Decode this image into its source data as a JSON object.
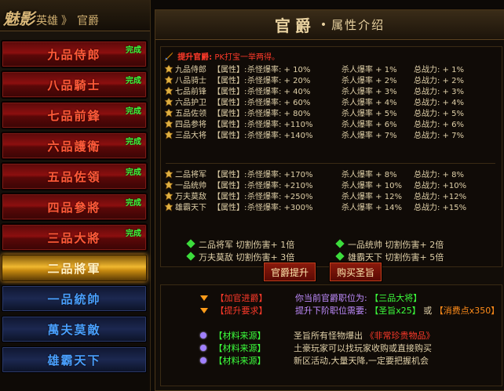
{
  "left": {
    "title_big": "魅影",
    "title_hero": "英雄",
    "title_sep": "》",
    "title_rank": "官爵",
    "ranks": [
      {
        "label": "九品侍郎",
        "badge": "完成",
        "state": "done"
      },
      {
        "label": "八品騎士",
        "badge": "完成",
        "state": "done"
      },
      {
        "label": "七品前鋒",
        "badge": "完成",
        "state": "done"
      },
      {
        "label": "六品護衛",
        "badge": "完成",
        "state": "done"
      },
      {
        "label": "五品佐領",
        "badge": "完成",
        "state": "done"
      },
      {
        "label": "四品參將",
        "badge": "完成",
        "state": "done"
      },
      {
        "label": "三品大將",
        "badge": "完成",
        "state": "done"
      },
      {
        "label": "二品將軍",
        "badge": "",
        "state": "current"
      },
      {
        "label": "一品統帥",
        "badge": "",
        "state": "locked"
      },
      {
        "label": "萬夫莫敵",
        "badge": "",
        "state": "locked"
      },
      {
        "label": "雄霸天下",
        "badge": "",
        "state": "locked"
      }
    ]
  },
  "right": {
    "title": "官爵",
    "dot": "•",
    "subtitle": "属性介绍",
    "tip_prefix": "提升官爵:",
    "tip_text": "PK打宝一举两得。",
    "rows": [
      {
        "name": "九品侍郎",
        "attr": "【属性】:",
        "c1": "杀怪爆率: + 10%",
        "c2": "杀人爆率 +  1%",
        "c3": "总战力: + 1%"
      },
      {
        "name": "八品骑士",
        "attr": "【属性】:",
        "c1": "杀怪爆率: + 20%",
        "c2": "杀人爆率 +  2%",
        "c3": "总战力: + 2%"
      },
      {
        "name": "七品前锋",
        "attr": "【属性】:",
        "c1": "杀怪爆率: + 40%",
        "c2": "杀人爆率 +  3%",
        "c3": "总战力: + 3%"
      },
      {
        "name": "六品护卫",
        "attr": "【属性】:",
        "c1": "杀怪爆率: + 60%",
        "c2": "杀人爆率 +  4%",
        "c3": "总战力: + 4%"
      },
      {
        "name": "五品佐领",
        "attr": "【属性】:",
        "c1": "杀怪爆率: + 80%",
        "c2": "杀人爆率 +  5%",
        "c3": "总战力: + 5%"
      },
      {
        "name": "四品参将",
        "attr": "【属性】:",
        "c1": "杀怪爆率: +110%",
        "c2": "杀人爆率 +  6%",
        "c3": "总战力: + 6%"
      },
      {
        "name": "三品大将",
        "attr": "【属性】:",
        "c1": "杀怪爆率: +140%",
        "c2": "杀人爆率 +  7%",
        "c3": "总战力: + 7%"
      },
      {
        "name": "二品将军",
        "attr": "【属性】:",
        "c1": "杀怪爆率: +170%",
        "c2": "杀人爆率 +  8%",
        "c3": "总战力: + 8%"
      },
      {
        "name": "一品统帅",
        "attr": "【属性】:",
        "c1": "杀怪爆率: +210%",
        "c2": "杀人爆率 + 10%",
        "c3": "总战力: +10%"
      },
      {
        "name": "万夫莫敌",
        "attr": "【属性】:",
        "c1": "杀怪爆率: +250%",
        "c2": "杀人爆率 + 12%",
        "c3": "总战力: +12%"
      },
      {
        "name": "雄霸天下",
        "attr": "【属性】:",
        "c1": "杀怪爆率: +300%",
        "c2": "杀人爆率 + 14%",
        "c3": "总战力: +15%"
      }
    ],
    "bonuses": [
      "二品将军  切割伤害+ 1倍",
      "一品统帅  切割伤害+ 2倍",
      "万夫莫敌  切割伤害+ 3倍",
      "雄霸天下  切割伤害+ 5倍"
    ],
    "btn_promote": "官爵提升",
    "btn_buy": "购买圣旨",
    "notes": {
      "n1_tag": "【加官进爵】",
      "n1_text": "你当前官爵职位为:",
      "n1_val": "【三品大将】",
      "n2_tag": "【提升要求】",
      "n2_text": "提升下阶职位需要:",
      "n2_v1": "【圣旨x25】",
      "n2_or": "或",
      "n2_v2": "【消费点x350】",
      "n3_tag": "【材料来源】",
      "n3_text": "圣旨所有怪物爆出",
      "n3_val": "《非常珍贵物品》",
      "n4_tag": "【材料来源】",
      "n4_text": "土豪玩家可以找玩家收购或直接购买",
      "n5_tag": "【材料来源】",
      "n5_text": "新区活动,大量天降,一定要把握机会"
    }
  },
  "colors": {
    "done_red": "#8c0f0f",
    "current_gold": "#f0b830",
    "locked_blue": "#1c2850",
    "badge_green": "#3cff3c"
  }
}
